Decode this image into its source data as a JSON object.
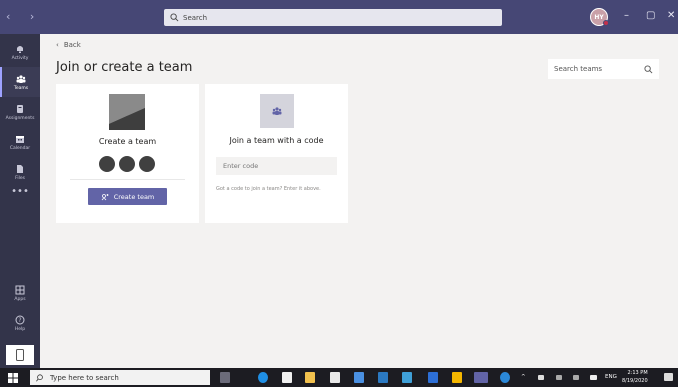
{
  "titlebar": {
    "search_placeholder": "Search",
    "avatar_initials": "HY"
  },
  "rail": {
    "items": [
      {
        "label": "Activity",
        "icon": "bell-icon"
      },
      {
        "label": "Teams",
        "icon": "teams-icon"
      },
      {
        "label": "Assignments",
        "icon": "assignments-icon"
      },
      {
        "label": "Calendar",
        "icon": "calendar-icon"
      },
      {
        "label": "Files",
        "icon": "file-icon"
      },
      {
        "label": "Apps",
        "icon": "apps-icon"
      },
      {
        "label": "Help",
        "icon": "help-icon"
      }
    ],
    "more": "•••"
  },
  "main": {
    "back_label": "Back",
    "title": "Join or create a team",
    "team_search_placeholder": "Search teams",
    "create_card": {
      "title": "Create a team",
      "button_label": "Create team"
    },
    "join_card": {
      "title": "Join a team with a code",
      "input_placeholder": "Enter code",
      "hint": "Got a code to join a team? Enter it above."
    }
  },
  "taskbar": {
    "search_placeholder": "Type here to search",
    "lang": "ENG",
    "time": "2:13 PM",
    "date": "8/19/2020"
  },
  "colors": {
    "titlebar": "#464775",
    "rail": "#33344a",
    "accent": "#6264a7"
  }
}
